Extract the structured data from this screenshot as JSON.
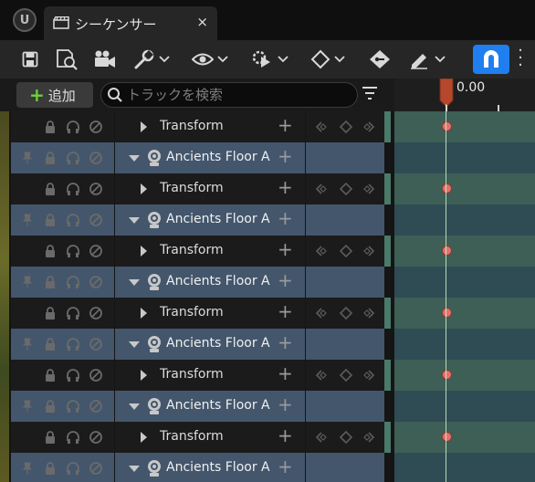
{
  "app": {
    "logo_text": "U"
  },
  "tab": {
    "title": "シーケンサー",
    "close": "×"
  },
  "toolbar": {
    "buttons": [
      {
        "name": "save-icon"
      },
      {
        "name": "browse-asset-icon"
      },
      {
        "name": "render-movie-icon"
      },
      {
        "name": "wrench-icon"
      },
      {
        "name": "eye-icon"
      },
      {
        "name": "playback-options-icon"
      },
      {
        "name": "keyframe-diamond-icon"
      },
      {
        "name": "key-tag-icon"
      },
      {
        "name": "pen-icon"
      },
      {
        "name": "magnet-snap-icon"
      }
    ],
    "snap_color": "#1f7ff0"
  },
  "search": {
    "add_label": "追加",
    "placeholder": "トラックを検索"
  },
  "timeline": {
    "current_time": "0.00"
  },
  "rows": [
    {
      "type": "sub",
      "label": "Transform"
    },
    {
      "type": "obj",
      "label": "Ancients Floor A (",
      "collapsed": false
    },
    {
      "type": "sub",
      "label": "Transform"
    },
    {
      "type": "obj",
      "label": "Ancients Floor A (",
      "collapsed": false
    },
    {
      "type": "sub",
      "label": "Transform"
    },
    {
      "type": "obj",
      "label": "Ancients Floor A (",
      "collapsed": false
    },
    {
      "type": "sub",
      "label": "Transform"
    },
    {
      "type": "obj",
      "label": "Ancients Floor A (",
      "collapsed": false
    },
    {
      "type": "sub",
      "label": "Transform"
    },
    {
      "type": "obj",
      "label": "Ancients Floor A (",
      "collapsed": false
    },
    {
      "type": "sub",
      "label": "Transform"
    },
    {
      "type": "obj",
      "label": "Ancients Floor A (",
      "collapsed": false
    }
  ],
  "colors": {
    "object_row": "#43566c",
    "track_row": "#1b1b1b",
    "keyframe": "#e0736b",
    "playhead": "#c0502f"
  }
}
